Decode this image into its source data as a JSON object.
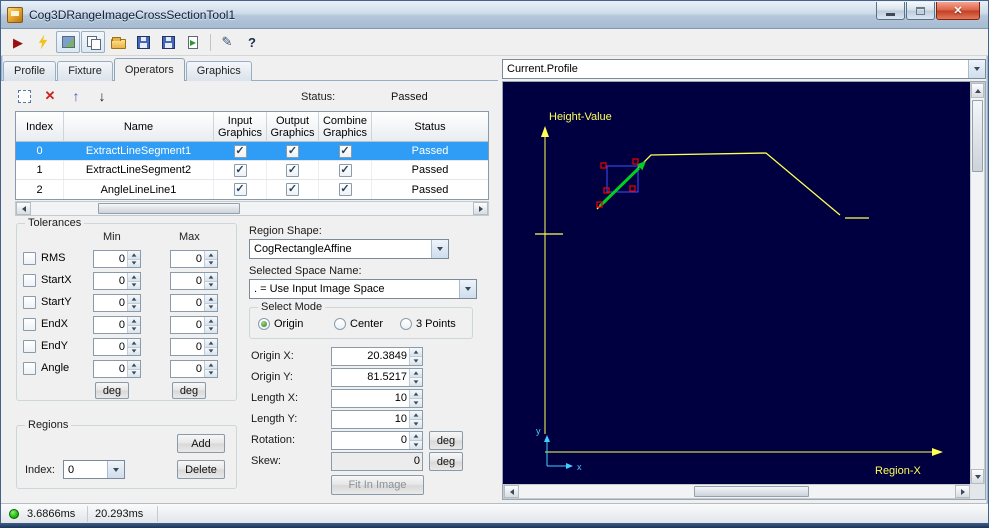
{
  "titlebar": {
    "title": "Cog3DRangeImageCrossSectionTool1"
  },
  "toolbar": {
    "run_glyph": "▶",
    "pen_glyph": "✎",
    "help_glyph": "?"
  },
  "tabs": {
    "items": [
      "Profile",
      "Fixture",
      "Operators",
      "Graphics"
    ],
    "active": "Operators"
  },
  "opbar": {
    "delete_glyph": "✕",
    "up_glyph": "↑",
    "down_glyph": "↓",
    "status_label": "Status:",
    "status_value": "Passed"
  },
  "grid": {
    "headers": {
      "index": "Index",
      "name": "Name",
      "input": "Input Graphics",
      "output": "Output Graphics",
      "combine": "Combine Graphics",
      "status": "Status"
    },
    "rows": [
      {
        "index": "0",
        "name": "ExtractLineSegment1",
        "status": "Passed"
      },
      {
        "index": "1",
        "name": "ExtractLineSegment2",
        "status": "Passed"
      },
      {
        "index": "2",
        "name": "AngleLineLine1",
        "status": "Passed"
      }
    ]
  },
  "tolerances": {
    "title": "Tolerances",
    "min": "Min",
    "max": "Max",
    "deg": "deg",
    "rows": [
      {
        "label": "RMS",
        "min": "0",
        "max": "0"
      },
      {
        "label": "StartX",
        "min": "0",
        "max": "0"
      },
      {
        "label": "StartY",
        "min": "0",
        "max": "0"
      },
      {
        "label": "EndX",
        "min": "0",
        "max": "0"
      },
      {
        "label": "EndY",
        "min": "0",
        "max": "0"
      },
      {
        "label": "Angle",
        "min": "0",
        "max": "0"
      }
    ]
  },
  "region": {
    "shape_label": "Region Shape:",
    "shape_value": "CogRectangleAffine",
    "space_label": "Selected Space Name:",
    "space_value": ". = Use Input Image Space",
    "mode_title": "Select Mode",
    "modes": [
      "Origin",
      "Center",
      "3 Points"
    ],
    "selected_mode": "Origin",
    "fields": [
      {
        "label": "Origin X:",
        "value": "20.3849"
      },
      {
        "label": "Origin Y:",
        "value": "81.5217"
      },
      {
        "label": "Length X:",
        "value": "10"
      },
      {
        "label": "Length Y:",
        "value": "10"
      },
      {
        "label": "Rotation:",
        "value": "0",
        "unit": "deg"
      },
      {
        "label": "Skew:",
        "value": "0",
        "unit": "deg"
      }
    ],
    "fit_button": "Fit In Image"
  },
  "regions_box": {
    "title": "Regions",
    "add": "Add",
    "index_label": "Index:",
    "index_value": "0",
    "delete": "Delete"
  },
  "display": {
    "selector": "Current.Profile",
    "y_axis": "Height-Value",
    "x_axis": "Region-X",
    "mini_x": "x",
    "mini_y": "y"
  },
  "statusbar": {
    "time1": "3.6866ms",
    "time2": "20.293ms"
  },
  "colors": {
    "selection": "#2f9cf5",
    "plot_bg": "#000040",
    "plot_line": "#ffff54",
    "region_arrow": "#00d020",
    "handles": "#e00000",
    "status_led": "#22c514"
  }
}
